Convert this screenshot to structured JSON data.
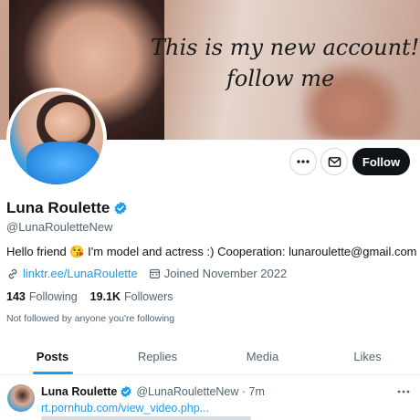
{
  "banner": {
    "line1": "This is my new account!",
    "line2": "follow me"
  },
  "actions": {
    "follow_label": "Follow"
  },
  "profile": {
    "name": "Luna Roulette",
    "handle": "@LunaRouletteNew",
    "bio": "Hello friend 😘 I'm model and actress :) Cooperation: lunaroulette@gmail.com",
    "link": "linktr.ee/LunaRoulette",
    "joined": "Joined November 2022",
    "following_count": "143",
    "following_label": "Following",
    "followers_count": "19.1K",
    "followers_label": "Followers",
    "not_followed": "Not followed by anyone you're following"
  },
  "tabs": [
    {
      "label": "Posts",
      "active": true
    },
    {
      "label": "Replies",
      "active": false
    },
    {
      "label": "Media",
      "active": false
    },
    {
      "label": "Likes",
      "active": false
    }
  ],
  "tweet": {
    "name": "Luna Roulette",
    "handle_time": "@LunaRouletteNew · 7m",
    "link": "rt.pornhub.com/view_video.php..."
  },
  "colors": {
    "accent": "#1d9bf0",
    "text": "#0f1419",
    "muted": "#536471"
  },
  "icons": [
    "more-icon",
    "mail-icon",
    "verified-badge-icon",
    "link-icon",
    "calendar-icon"
  ]
}
